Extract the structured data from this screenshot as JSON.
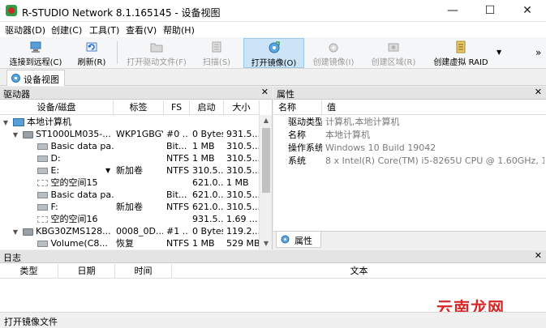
{
  "window": {
    "title": "R-STUDIO Network 8.1.165145 - 设备视图",
    "min": "—",
    "max": "☐",
    "close": "✕"
  },
  "menu": [
    "驱动器(D)",
    "创建(C)",
    "工具(T)",
    "查看(V)",
    "帮助(H)"
  ],
  "toolbar": {
    "connect": "连接到远程(C)",
    "refresh": "刷新(R)",
    "open_drive_files": "打开驱动文件(F)",
    "scan": "扫描(S)",
    "open_image": "打开镜像(O)",
    "create_image": "创建镜像(I)",
    "create_region": "创建区域(R)",
    "create_raid": "创建虚拟 RAID",
    "more": "»"
  },
  "doc_tab": {
    "label": "设备视图"
  },
  "drives_pane": {
    "title": "驱动器",
    "columns": [
      "设备/磁盘",
      "标签",
      "FS",
      "启动",
      "大小"
    ],
    "rows": [
      {
        "name": "本地计算机",
        "label": "",
        "fs": "",
        "start": "",
        "size": ""
      },
      {
        "name": "ST1000LM035-...",
        "label": "WKP1GBGY",
        "fs": "#0 ...",
        "start": "0 Bytes",
        "size": "931.5..."
      },
      {
        "name": "Basic data pa...",
        "label": "",
        "fs": "Bit...",
        "start": "1 MB",
        "size": "310.5..."
      },
      {
        "name": "D:",
        "label": "",
        "fs": "NTFS",
        "start": "1 MB",
        "size": "310.5..."
      },
      {
        "name": "E:",
        "label": "新加卷",
        "fs": "NTFS",
        "start": "310.5...",
        "size": "310.5..."
      },
      {
        "name": "空的空间15",
        "label": "",
        "fs": "",
        "start": "621.0...",
        "size": "1 MB"
      },
      {
        "name": "Basic data pa...",
        "label": "",
        "fs": "Bit...",
        "start": "621.0...",
        "size": "310.5..."
      },
      {
        "name": "F:",
        "label": "新加卷",
        "fs": "NTFS",
        "start": "621.0...",
        "size": "310.5..."
      },
      {
        "name": "空的空间16",
        "label": "",
        "fs": "",
        "start": "931.5...",
        "size": "1.69 ..."
      },
      {
        "name": "KBG30ZMS128...",
        "label": "0008_0D...",
        "fs": "#1 ...",
        "start": "0 Bytes",
        "size": "119.2..."
      },
      {
        "name": "Volume(C8...",
        "label": "恢复",
        "fs": "NTFS",
        "start": "1 MB",
        "size": "529 MB"
      }
    ]
  },
  "props_pane": {
    "title": "属性",
    "columns": [
      "名称",
      "值"
    ],
    "rows": [
      {
        "name": "驱动类型",
        "value": "计算机,本地计算机"
      },
      {
        "name": "名称",
        "value": "本地计算机"
      },
      {
        "name": "操作系统",
        "value": "Windows 10 Build 19042"
      },
      {
        "name": "系统",
        "value": "8 x Intel(R) Core(TM) i5-8265U CPU @ 1.60GHz, 18..."
      }
    ],
    "tab": "属性"
  },
  "log_pane": {
    "title": "日志",
    "columns": [
      "类型",
      "日期",
      "时间",
      "文本"
    ]
  },
  "status": "打开镜像文件",
  "watermark": "云南龙网"
}
